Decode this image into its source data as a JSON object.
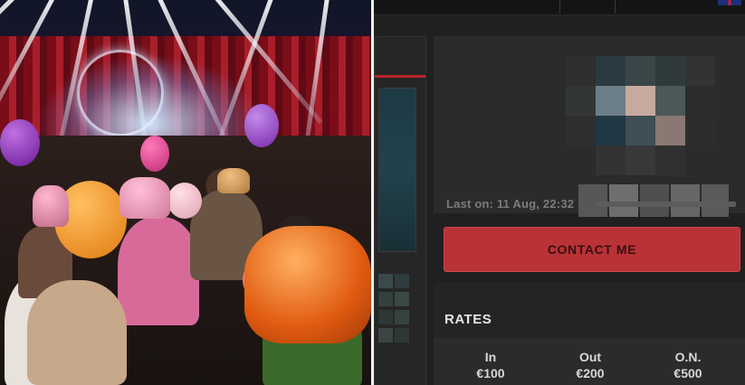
{
  "photo": {
    "description_icon": "concert-crowd-image"
  },
  "profile": {
    "last_on": "Last on: 11 Aug, 22:32",
    "contact_label": "CONTACT ME"
  },
  "rates": {
    "title": "RATES",
    "items": [
      {
        "label": "In",
        "value": "€100"
      },
      {
        "label": "Out",
        "value": "€200"
      },
      {
        "label": "O.N.",
        "value": "€500"
      }
    ]
  },
  "colors": {
    "contact_button": "#b83236",
    "panel": "#2b2b2b",
    "background": "#202020"
  }
}
